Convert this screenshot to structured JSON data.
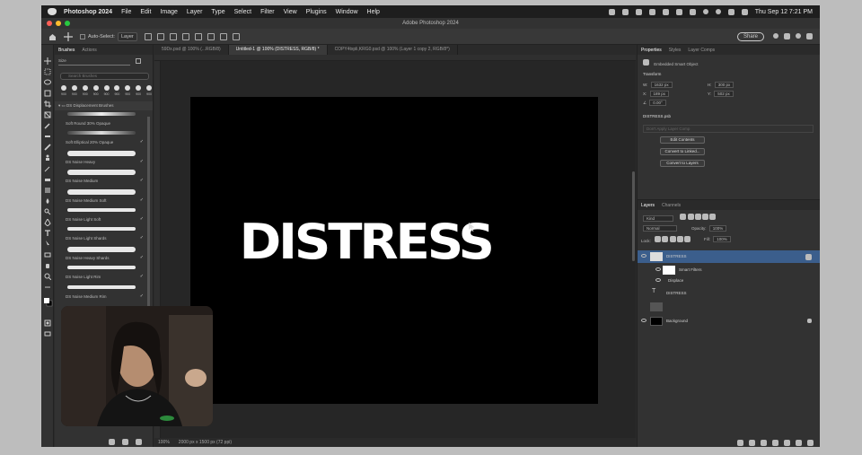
{
  "menubar": {
    "app_name": "Photoshop 2024",
    "items": [
      "File",
      "Edit",
      "Image",
      "Layer",
      "Type",
      "Select",
      "Filter",
      "View",
      "Plugins",
      "Window",
      "Help"
    ],
    "datetime": "Thu Sep 12  7:21 PM"
  },
  "window": {
    "title": "Adobe Photoshop 2024"
  },
  "options_bar": {
    "auto_select_label": "Auto-Select:",
    "auto_select_value": "Layer",
    "share_label": "Share"
  },
  "brushes_panel": {
    "tabs": [
      "Brushes",
      "Actions"
    ],
    "size_label": "Size",
    "search_placeholder": "Search Brushes",
    "tip_sizes": [
      "900",
      "900",
      "900",
      "900",
      "900",
      "900",
      "900",
      "900",
      "900"
    ],
    "group_name": "DS Displacement Brushes",
    "items": [
      {
        "name": "Soft Round 30% Opaque"
      },
      {
        "name": "Soft Elliptical 20% Opaque"
      },
      {
        "name": "DS Noise Heavy"
      },
      {
        "name": "DS Noise Medium"
      },
      {
        "name": "DS Noise Medium Soft"
      },
      {
        "name": "DS Noise Light Soft"
      },
      {
        "name": "DS Noise Light Shards"
      },
      {
        "name": "DS Noise Heavy Shards"
      },
      {
        "name": "DS Noise Light Rim"
      },
      {
        "name": "DS Noise Medium Rim"
      }
    ]
  },
  "doc_tabs": [
    {
      "label": "59Dx.psd @ 100% (...RGB/8)",
      "active": false
    },
    {
      "label": "Untitled-1 @ 100% (DISTRESS, RGB/8) *",
      "active": true
    },
    {
      "label": "COPY4txpli,KRG0.psd @ 100% (Layer 1 copy 2, RGB/8*)",
      "active": false
    }
  ],
  "canvas": {
    "text": "DISTRESS"
  },
  "status": {
    "zoom": "100%",
    "doc_info": "2000 px x 1500 px (72 ppi)"
  },
  "properties": {
    "tabs": [
      "Properties",
      "Styles",
      "Layer Comps"
    ],
    "object_type": "Embedded Smart Object",
    "transform_label": "Transform",
    "w": "1632 px",
    "h": "300 px",
    "x": "189 px",
    "y": "502 px",
    "angle": "0.00°",
    "file_name": "DISTRESS.psb",
    "layer_comp_placeholder": "Don't Apply Layer Comp",
    "buttons": [
      "Edit Contents",
      "Convert to Linked...",
      "Convert to Layers"
    ]
  },
  "layers_panel": {
    "tabs": [
      "Layers",
      "Channels"
    ],
    "filter_label": "Kind",
    "blend_mode": "Normal",
    "opacity_label": "Opacity:",
    "opacity": "100%",
    "lock_label": "Lock:",
    "fill_label": "Fill:",
    "fill": "100%",
    "layers": [
      {
        "name": "DISTRESS"
      },
      {
        "name": "Smart Filters"
      },
      {
        "name": "Displace"
      },
      {
        "name": "DISTRESS"
      },
      {
        "name": ""
      },
      {
        "name": "Background"
      }
    ]
  },
  "colors": {
    "canvas": "#000000",
    "panel": "#323232",
    "selection": "#3b5e8c",
    "text": "#ffffff"
  }
}
